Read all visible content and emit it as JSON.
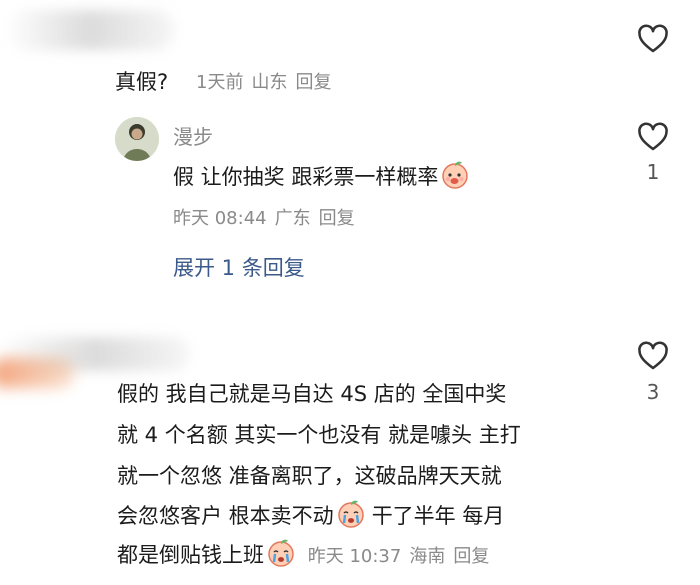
{
  "comments": [
    {
      "text": "真假?",
      "meta": {
        "time": "1天前",
        "location": "山东",
        "reply": "回复"
      },
      "replies": [
        {
          "nickname": "漫步",
          "text": "假 让你抽奖  跟彩票一样概率",
          "emoji": "shy-peach-emoji",
          "meta": {
            "time": "昨天 08:44",
            "location": "广东",
            "reply": "回复"
          },
          "likes": "1"
        }
      ],
      "expand_label": "展开 1 条回复"
    },
    {
      "lines": [
        "假的 我自己就是马自达 4S 店的 全国中奖",
        "就 4 个名额 其实一个也没有 就是噱头 主打",
        "就一个忽悠 准备离职了，这破品牌天天就",
        "会忽悠客户 根本卖不动",
        "干了半年 每月",
        "都是倒贴钱上班"
      ],
      "meta": {
        "time": "昨天 10:37",
        "location": "海南",
        "reply": "回复"
      },
      "likes": "3"
    }
  ]
}
